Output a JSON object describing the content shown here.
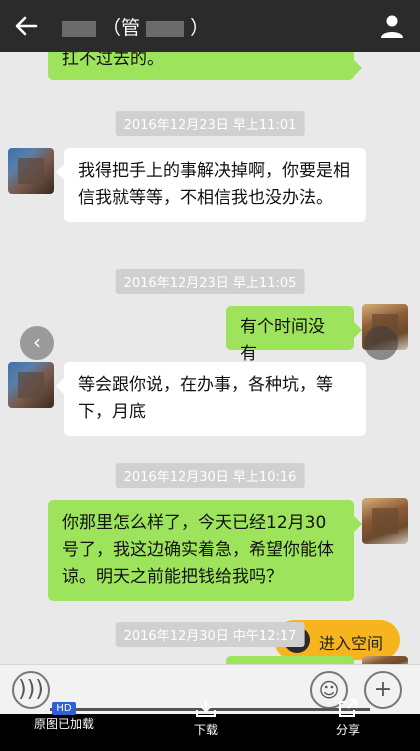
{
  "header": {
    "title_prefix": "",
    "title_mid": "（管",
    "title_suffix": "）",
    "back_icon": "back-arrow-icon",
    "user_icon": "user-icon"
  },
  "messages": [
    {
      "type": "text",
      "side": "right",
      "text": "扛不过去的。"
    },
    {
      "type": "timestamp",
      "text": "2016年12月23日 早上11:01"
    },
    {
      "type": "text",
      "side": "left",
      "text": "我得把手上的事解决掉啊，你要是相信我就等等，不相信我也没办法。"
    },
    {
      "type": "timestamp",
      "text": "2016年12月23日 早上11:05"
    },
    {
      "type": "text",
      "side": "right",
      "text": "有个时间没有"
    },
    {
      "type": "text",
      "side": "left",
      "text": "等会跟你说，在办事，各种坑，等下，月底"
    },
    {
      "type": "timestamp",
      "text": "2016年12月30日 早上10:16"
    },
    {
      "type": "text",
      "side": "right",
      "text": "你那里怎么样了，今天已经12月30号了，我这边确实着急，希望你能体谅。明天之前能把钱给我吗？"
    },
    {
      "type": "timestamp",
      "text": "2016年12月30日 中午12:17"
    }
  ],
  "qzone": {
    "label": "进入空间"
  },
  "viewer": {
    "hd_badge": "HD",
    "original_label": "原图已加载",
    "download_label": "下载",
    "share_label": "分享"
  },
  "colors": {
    "header_bg": "#2b2b2b",
    "chat_bg": "#e9e9e9",
    "bubble_right": "#9de35b",
    "bubble_left": "#ffffff",
    "qzone_bg": "#f6b51e",
    "hd_badge": "#2f5fd3"
  }
}
